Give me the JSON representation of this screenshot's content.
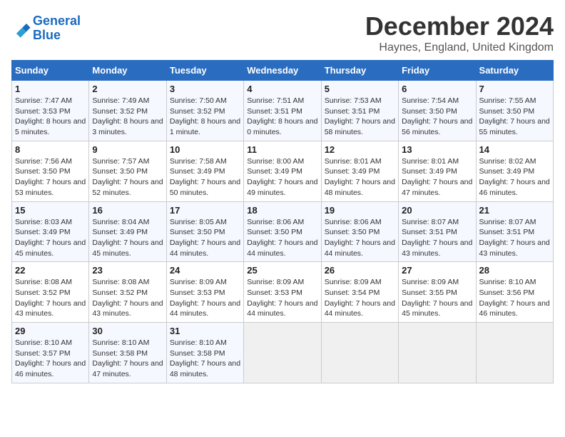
{
  "logo": {
    "line1": "General",
    "line2": "Blue"
  },
  "title": "December 2024",
  "subtitle": "Haynes, England, United Kingdom",
  "days_header": [
    "Sunday",
    "Monday",
    "Tuesday",
    "Wednesday",
    "Thursday",
    "Friday",
    "Saturday"
  ],
  "weeks": [
    [
      {
        "day": "1",
        "sunrise": "7:47 AM",
        "sunset": "3:53 PM",
        "daylight": "8 hours and 5 minutes."
      },
      {
        "day": "2",
        "sunrise": "7:49 AM",
        "sunset": "3:52 PM",
        "daylight": "8 hours and 3 minutes."
      },
      {
        "day": "3",
        "sunrise": "7:50 AM",
        "sunset": "3:52 PM",
        "daylight": "8 hours and 1 minute."
      },
      {
        "day": "4",
        "sunrise": "7:51 AM",
        "sunset": "3:51 PM",
        "daylight": "8 hours and 0 minutes."
      },
      {
        "day": "5",
        "sunrise": "7:53 AM",
        "sunset": "3:51 PM",
        "daylight": "7 hours and 58 minutes."
      },
      {
        "day": "6",
        "sunrise": "7:54 AM",
        "sunset": "3:50 PM",
        "daylight": "7 hours and 56 minutes."
      },
      {
        "day": "7",
        "sunrise": "7:55 AM",
        "sunset": "3:50 PM",
        "daylight": "7 hours and 55 minutes."
      }
    ],
    [
      {
        "day": "8",
        "sunrise": "7:56 AM",
        "sunset": "3:50 PM",
        "daylight": "7 hours and 53 minutes."
      },
      {
        "day": "9",
        "sunrise": "7:57 AM",
        "sunset": "3:50 PM",
        "daylight": "7 hours and 52 minutes."
      },
      {
        "day": "10",
        "sunrise": "7:58 AM",
        "sunset": "3:49 PM",
        "daylight": "7 hours and 50 minutes."
      },
      {
        "day": "11",
        "sunrise": "8:00 AM",
        "sunset": "3:49 PM",
        "daylight": "7 hours and 49 minutes."
      },
      {
        "day": "12",
        "sunrise": "8:01 AM",
        "sunset": "3:49 PM",
        "daylight": "7 hours and 48 minutes."
      },
      {
        "day": "13",
        "sunrise": "8:01 AM",
        "sunset": "3:49 PM",
        "daylight": "7 hours and 47 minutes."
      },
      {
        "day": "14",
        "sunrise": "8:02 AM",
        "sunset": "3:49 PM",
        "daylight": "7 hours and 46 minutes."
      }
    ],
    [
      {
        "day": "15",
        "sunrise": "8:03 AM",
        "sunset": "3:49 PM",
        "daylight": "7 hours and 45 minutes."
      },
      {
        "day": "16",
        "sunrise": "8:04 AM",
        "sunset": "3:49 PM",
        "daylight": "7 hours and 45 minutes."
      },
      {
        "day": "17",
        "sunrise": "8:05 AM",
        "sunset": "3:50 PM",
        "daylight": "7 hours and 44 minutes."
      },
      {
        "day": "18",
        "sunrise": "8:06 AM",
        "sunset": "3:50 PM",
        "daylight": "7 hours and 44 minutes."
      },
      {
        "day": "19",
        "sunrise": "8:06 AM",
        "sunset": "3:50 PM",
        "daylight": "7 hours and 44 minutes."
      },
      {
        "day": "20",
        "sunrise": "8:07 AM",
        "sunset": "3:51 PM",
        "daylight": "7 hours and 43 minutes."
      },
      {
        "day": "21",
        "sunrise": "8:07 AM",
        "sunset": "3:51 PM",
        "daylight": "7 hours and 43 minutes."
      }
    ],
    [
      {
        "day": "22",
        "sunrise": "8:08 AM",
        "sunset": "3:52 PM",
        "daylight": "7 hours and 43 minutes."
      },
      {
        "day": "23",
        "sunrise": "8:08 AM",
        "sunset": "3:52 PM",
        "daylight": "7 hours and 43 minutes."
      },
      {
        "day": "24",
        "sunrise": "8:09 AM",
        "sunset": "3:53 PM",
        "daylight": "7 hours and 44 minutes."
      },
      {
        "day": "25",
        "sunrise": "8:09 AM",
        "sunset": "3:53 PM",
        "daylight": "7 hours and 44 minutes."
      },
      {
        "day": "26",
        "sunrise": "8:09 AM",
        "sunset": "3:54 PM",
        "daylight": "7 hours and 44 minutes."
      },
      {
        "day": "27",
        "sunrise": "8:09 AM",
        "sunset": "3:55 PM",
        "daylight": "7 hours and 45 minutes."
      },
      {
        "day": "28",
        "sunrise": "8:10 AM",
        "sunset": "3:56 PM",
        "daylight": "7 hours and 46 minutes."
      }
    ],
    [
      {
        "day": "29",
        "sunrise": "8:10 AM",
        "sunset": "3:57 PM",
        "daylight": "7 hours and 46 minutes."
      },
      {
        "day": "30",
        "sunrise": "8:10 AM",
        "sunset": "3:58 PM",
        "daylight": "7 hours and 47 minutes."
      },
      {
        "day": "31",
        "sunrise": "8:10 AM",
        "sunset": "3:58 PM",
        "daylight": "7 hours and 48 minutes."
      },
      null,
      null,
      null,
      null
    ]
  ],
  "labels": {
    "sunrise": "Sunrise:",
    "sunset": "Sunset:",
    "daylight": "Daylight:"
  }
}
